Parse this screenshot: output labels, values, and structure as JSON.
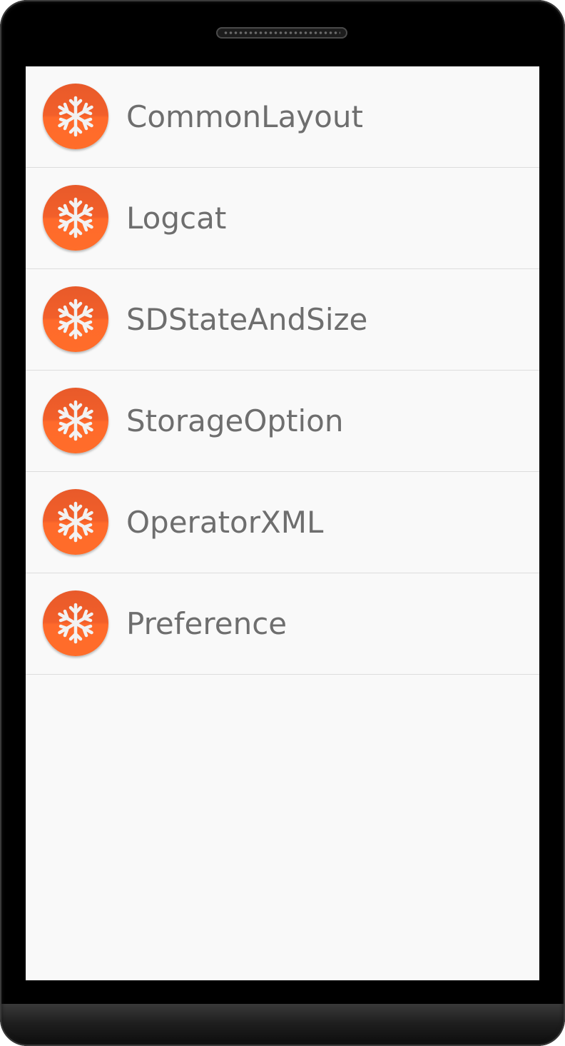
{
  "app_list": {
    "items": [
      {
        "label": "CommonLayout",
        "icon": "snowflake-icon"
      },
      {
        "label": "Logcat",
        "icon": "snowflake-icon"
      },
      {
        "label": "SDStateAndSize",
        "icon": "snowflake-icon"
      },
      {
        "label": "StorageOption",
        "icon": "snowflake-icon"
      },
      {
        "label": "OperatorXML",
        "icon": "snowflake-icon"
      },
      {
        "label": "Preference",
        "icon": "snowflake-icon"
      }
    ]
  },
  "colors": {
    "icon_background": "#ff6a2b",
    "icon_glyph": "#f2f2f2",
    "screen_background": "#f9f9f9",
    "label_text": "#6e6e6e",
    "divider": "#dddddd",
    "device_frame": "#000000"
  }
}
